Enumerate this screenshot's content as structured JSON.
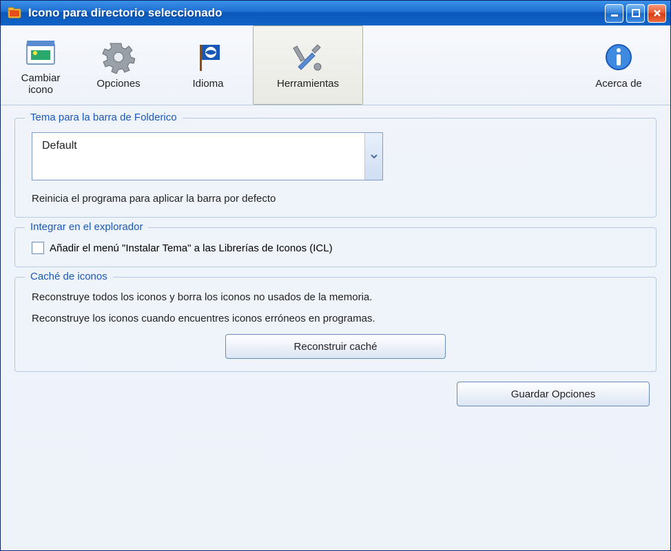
{
  "window": {
    "title": "Icono para directorio seleccionado"
  },
  "toolbar": {
    "change_icon": "Cambiar icono",
    "options": "Opciones",
    "language": "Idioma",
    "tools": "Herramientas",
    "about": "Acerca de"
  },
  "theme_group": {
    "title": "Tema para la barra de Folderico",
    "selected": "Default",
    "hint": "Reinicia el programa para aplicar la barra por defecto"
  },
  "explorer_group": {
    "title": "Integrar en el explorador",
    "checkbox_label": "Añadir el menú \"Instalar Tema\" a las Librerías de Iconos (ICL)"
  },
  "cache_group": {
    "title": "Caché de iconos",
    "line1": "Reconstruye todos los iconos y borra los iconos no usados de la memoria.",
    "line2": "Reconstruye los iconos cuando encuentres iconos erróneos en programas.",
    "rebuild_button": "Reconstruir caché"
  },
  "footer": {
    "save_button": "Guardar Opciones"
  }
}
